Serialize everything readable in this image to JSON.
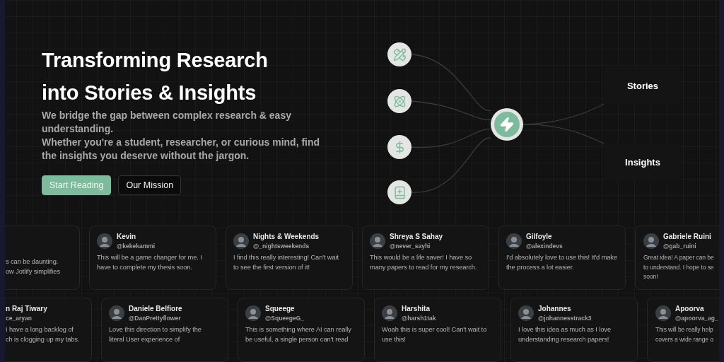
{
  "hero": {
    "title_lines": [
      "Transforming Research",
      "into Stories & Insights"
    ],
    "description": [
      "We bridge the gap between complex research & easy understanding.",
      "Whether you're a student, researcher, or curious mind, find the insights you deserve without the jargon."
    ],
    "buttons": [
      {
        "label": "Start Reading",
        "kind": "primary"
      },
      {
        "label": "Our Mission",
        "kind": "secondary"
      }
    ]
  },
  "diagram": {
    "outputs": [
      "Stories",
      "Insights"
    ]
  },
  "testimonials": [
    [
      {
        "kind": "cut-left",
        "text": "s can be daunting.\now Jotlify simplifies"
      },
      {
        "kind": "full",
        "name": "Kevin",
        "handle": "@kekekammi",
        "text": "This will be a game changer for me. I have to complete my thesis soon."
      },
      {
        "kind": "full",
        "name": "Nights & Weekends",
        "handle": "@_nightsweekends",
        "text": "I find this really interesting! Can't wait to see the first version of it!"
      },
      {
        "kind": "full",
        "name": "Shreya S Sahay",
        "handle": "@never_sayhi",
        "text": "This would be a life saver! I have so many papers to read for my research."
      },
      {
        "kind": "full",
        "name": "Gilfoyle",
        "handle": "@alexindevs",
        "text": "I'd absolutely love to use this! It'd make the process a lot easier."
      },
      {
        "kind": "cut-right",
        "name": "Gabriele Ruini",
        "handle": "@gab_ruini",
        "text": "Great idea! A paper can be\nto understand. I hope to se\nsoon!"
      }
    ],
    [
      {
        "kind": "cut-left",
        "name": "n Raj Tiwary",
        "handle": "ce_aryan",
        "text": "I have a long backlog of\nch is clogging up my tabs."
      },
      {
        "kind": "full",
        "name": "Daniele Belfiore",
        "handle": "@DanPrettyflower",
        "text": "Love this direction to simplify the\nliteral User experience of"
      },
      {
        "kind": "full",
        "name": "Squeege",
        "handle": "@SqueegeG_",
        "text": "This is something where AI can really\nbe useful, a single person can't read"
      },
      {
        "kind": "full",
        "name": "Harshita",
        "handle": "@harsh1tak",
        "text": "Woah this is super cool! Can't wait to\nuse this!"
      },
      {
        "kind": "full",
        "name": "Johannes",
        "handle": "@johannesstrack3",
        "text": "I love this idea as much as I love\nunderstanding research papers!"
      },
      {
        "kind": "cut-right",
        "name": "Apoorva",
        "handle": "@apoorva_ag_",
        "text": "This will be really help\ncovers a wide range o"
      }
    ]
  ]
}
